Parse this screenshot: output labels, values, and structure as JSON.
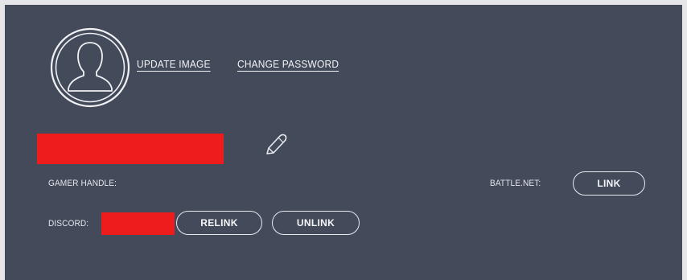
{
  "profile": {
    "avatar_icon": "user-silhouette-icon",
    "update_image_label": "UPDATE IMAGE",
    "change_password_label": "CHANGE PASSWORD",
    "edit_icon": "pencil-icon"
  },
  "accounts": {
    "gamer_handle_label": "GAMER HANDLE:",
    "battlenet_label": "BATTLE.NET:",
    "battlenet_button": "LINK",
    "discord_label": "DISCORD:",
    "discord_relink_button": "RELINK",
    "discord_unlink_button": "UNLINK"
  },
  "colors": {
    "panel_background": "#434a5a",
    "redaction": "#ee1c1c",
    "text": "#f2f3f5"
  }
}
